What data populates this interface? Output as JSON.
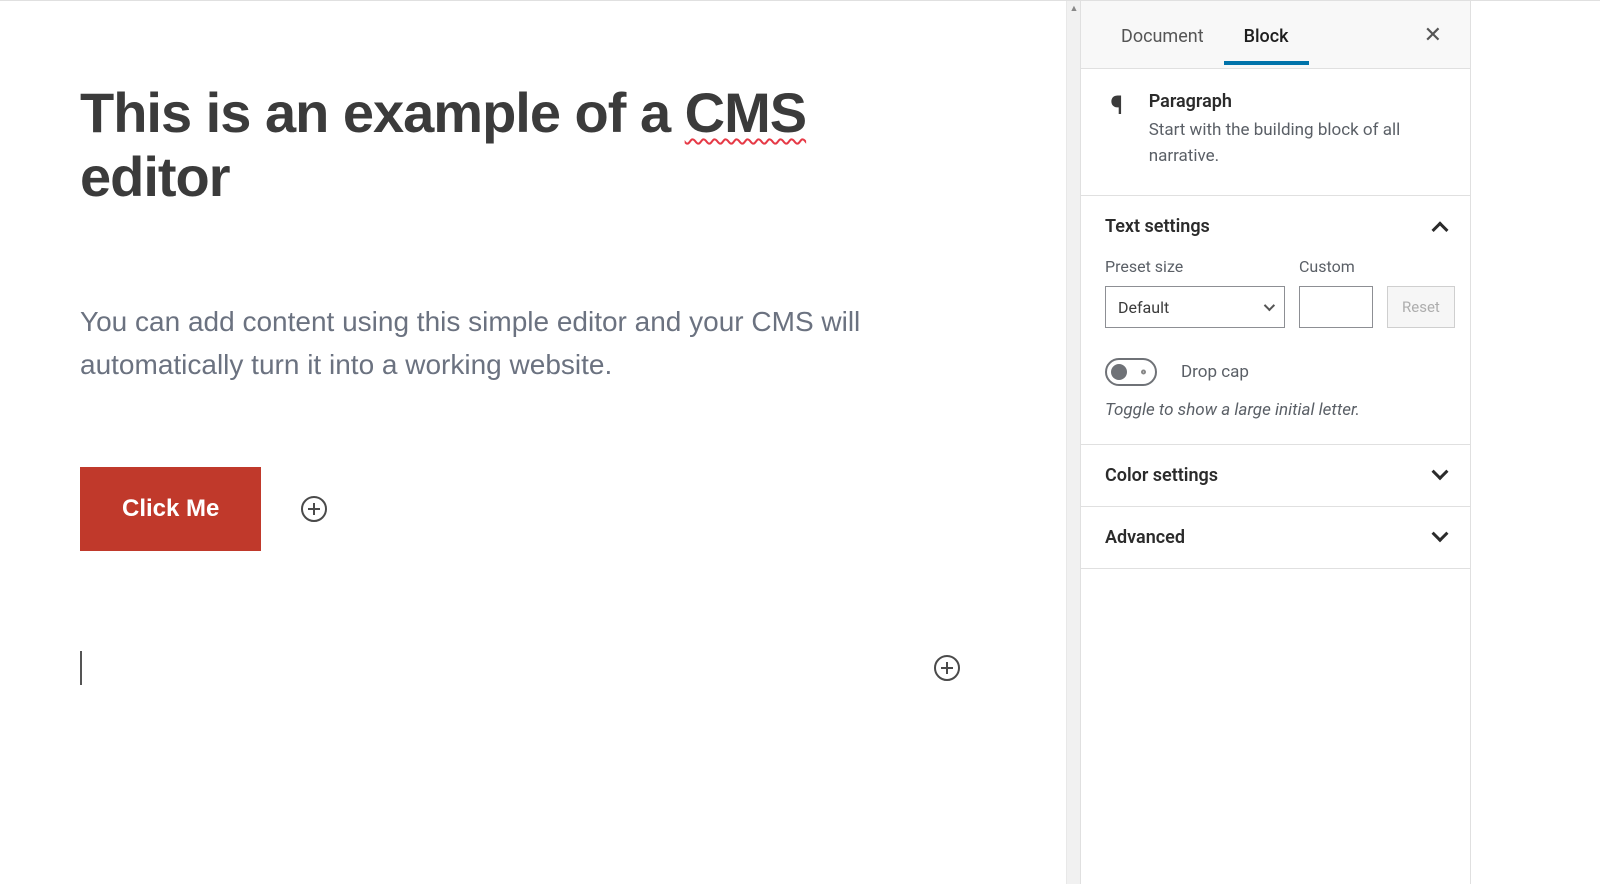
{
  "editor": {
    "heading_before": "This is an example of a ",
    "heading_misspelled": "CMS",
    "heading_after": " editor",
    "paragraph": "You can add content using this simple editor and your CMS will automatically turn it into a working website.",
    "button_label": "Click Me"
  },
  "sidebar": {
    "tabs": {
      "document": "Document",
      "block": "Block"
    },
    "active_tab": "block",
    "block": {
      "name": "Paragraph",
      "description": "Start with the building block of all narrative."
    },
    "panels": {
      "text_settings": {
        "title": "Text settings",
        "preset_label": "Preset size",
        "preset_value": "Default",
        "custom_label": "Custom",
        "custom_value": "",
        "reset_label": "Reset",
        "dropcap_label": "Drop cap",
        "dropcap_help": "Toggle to show a large initial letter.",
        "dropcap_on": false
      },
      "color_settings": {
        "title": "Color settings"
      },
      "advanced": {
        "title": "Advanced"
      }
    }
  }
}
